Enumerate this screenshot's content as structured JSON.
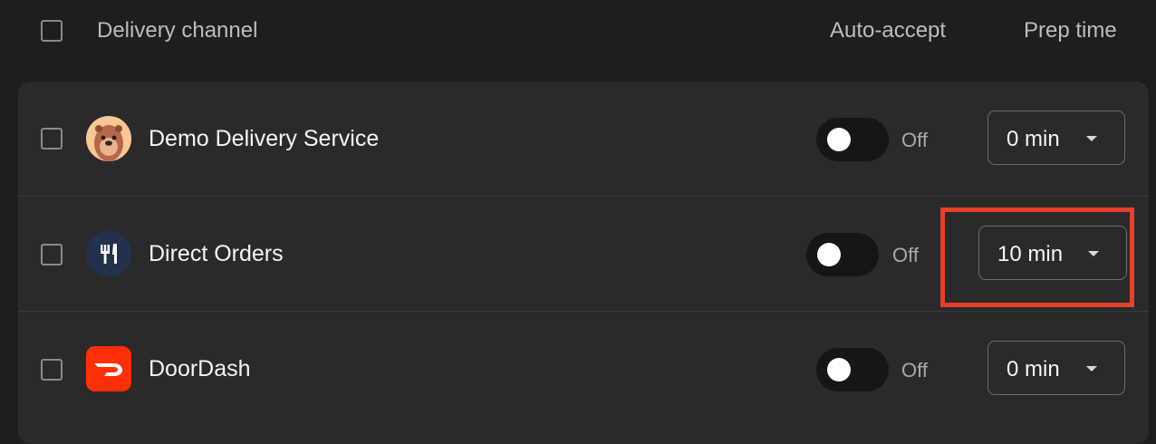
{
  "header": {
    "channel_label": "Delivery channel",
    "auto_accept_label": "Auto-accept",
    "prep_time_label": "Prep time"
  },
  "rows": [
    {
      "name": "Demo Delivery Service",
      "icon": "otter-mascot-icon",
      "auto_accept": "Off",
      "prep_time": "0 min"
    },
    {
      "name": "Direct Orders",
      "icon": "fork-knife-icon",
      "auto_accept": "Off",
      "prep_time": "10 min"
    },
    {
      "name": "DoorDash",
      "icon": "doordash-logo-icon",
      "auto_accept": "Off",
      "prep_time": "0 min"
    }
  ],
  "colors": {
    "background": "#1e1e1e",
    "panel": "#2a2a2a",
    "highlight": "#e5402b",
    "doordash": "#ff3008",
    "direct_orders": "#22324d"
  }
}
